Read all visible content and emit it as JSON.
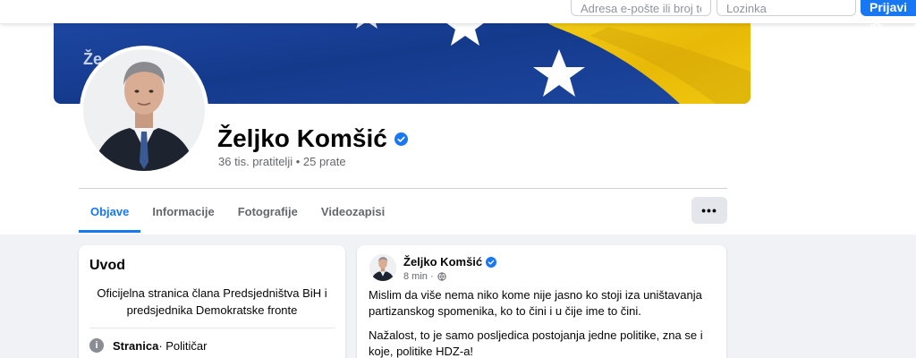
{
  "login": {
    "email_placeholder": "Adresa e-pošte ili broj telefona",
    "password_placeholder": "Lozinka",
    "login_button": "Prijavi se"
  },
  "cover": {
    "overlay_text": "Že"
  },
  "profile": {
    "name": "Željko Komšić",
    "stats": "36 tis. pratitelji • 25 prate",
    "verified": true
  },
  "tabs": {
    "items": [
      {
        "label": "Objave",
        "active": true
      },
      {
        "label": "Informacije",
        "active": false
      },
      {
        "label": "Fotografije",
        "active": false
      },
      {
        "label": "Videozapisi",
        "active": false
      }
    ],
    "more": "•••"
  },
  "intro": {
    "title": "Uvod",
    "bio": "Oficijelna stranica člana Predsjedništva BiH i predsjednika Demokratske fronte",
    "category_type": "Stranica",
    "category_value": " · Političar"
  },
  "post": {
    "author": "Željko Komšić",
    "time": "8 min ·",
    "paragraphs": [
      "Mislim da više nema niko kome nije jasno ko stoji iza uništavanja partizanskog spomenika, ko to čini i u čije ime to čini.",
      "Nažalost, to je samo posljedica postojanja jedne politike, zna se i koje, politike HDZ-a!"
    ]
  },
  "colors": {
    "accent": "#1877f2",
    "flag_blue": "#1c3f94",
    "flag_yellow": "#f2c90a",
    "background": "#f0f2f5"
  },
  "icons": [
    "verified-badge-icon",
    "globe-icon",
    "info-icon",
    "more-icon"
  ]
}
